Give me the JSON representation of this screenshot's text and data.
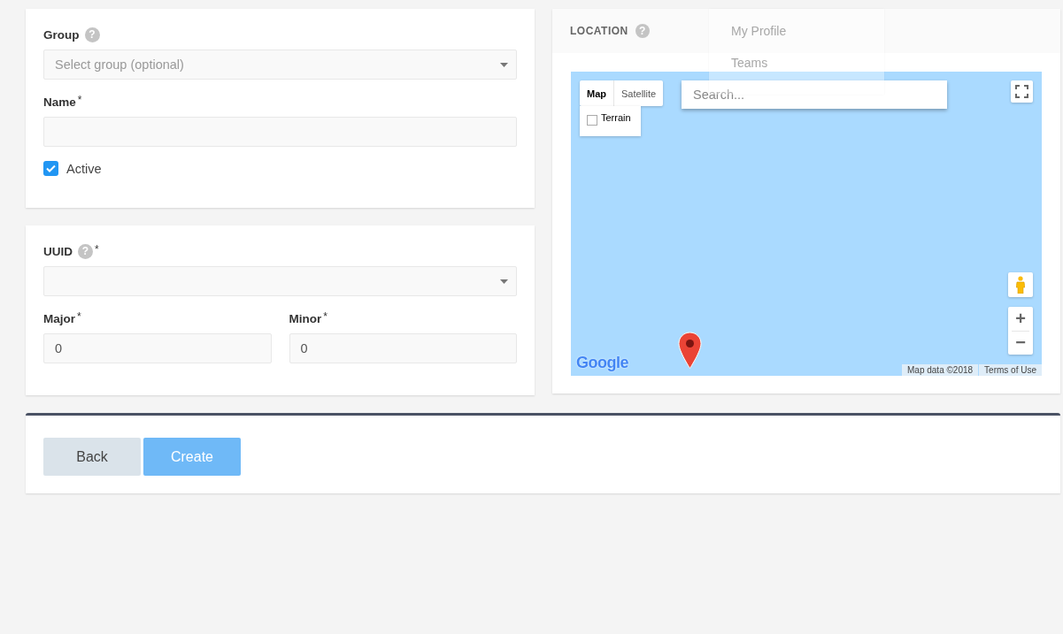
{
  "panels": [
    {
      "fields": [
        {
          "kind": "select",
          "label": "Group",
          "help": "?",
          "placeholder": "Select group (optional)"
        },
        {
          "kind": "text",
          "label": "Name",
          "required": "*"
        },
        {
          "kind": "checkbox",
          "label": "Active",
          "checked": true
        }
      ]
    },
    {
      "fields": [
        {
          "kind": "select",
          "label": "UUID",
          "help": "?",
          "required": "*"
        },
        {
          "kind": "row",
          "fields": [
            {
              "kind": "text",
              "label": "Major",
              "required": "*",
              "value": "0"
            },
            {
              "kind": "text",
              "label": "Minor",
              "required": "*",
              "value": "0"
            }
          ]
        }
      ]
    }
  ],
  "location": {
    "title": "LOCATION",
    "help": "?",
    "map": {
      "map_types": [
        {
          "label": "Map",
          "selected": true
        },
        {
          "label": "Satellite",
          "selected": false
        }
      ],
      "terrain": {
        "label": "Terrain",
        "checked": false
      },
      "search": {
        "placeholder": "Search..."
      },
      "zoom_in": "+",
      "zoom_out": "−",
      "logo": "Google",
      "attribution": [
        "Map data ©2018",
        "Terms of Use"
      ]
    }
  },
  "menu": {
    "items": [
      "My Profile",
      "Teams"
    ]
  },
  "actions": [
    {
      "label": "Back",
      "kind": "secondary"
    },
    {
      "label": "Create",
      "kind": "primary"
    }
  ]
}
